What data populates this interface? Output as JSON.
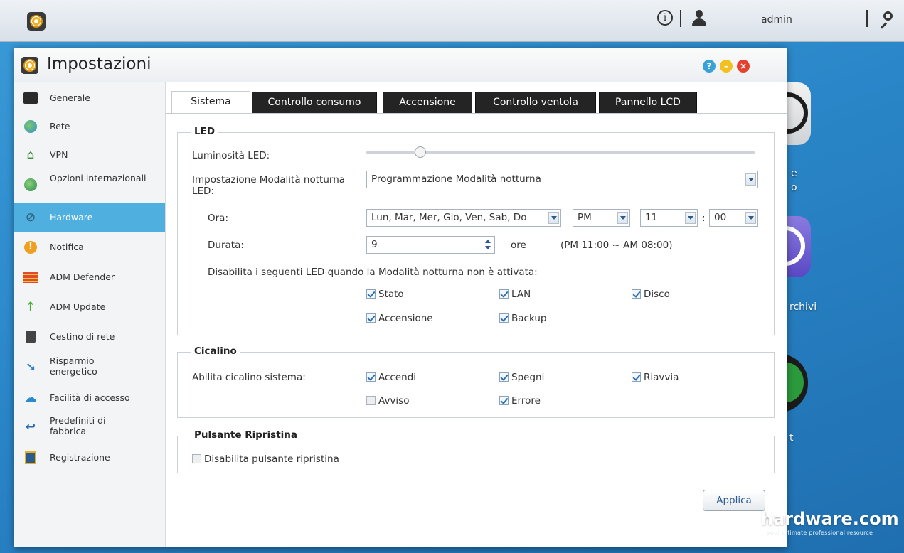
{
  "topbar": {
    "user": "admin"
  },
  "desktop": {
    "label_e": "e",
    "label_o": "o",
    "label_archivi": "rchivi",
    "label_t": "t"
  },
  "window": {
    "title": "Impostazioni"
  },
  "sidebar": {
    "items": [
      {
        "label": "Generale",
        "icon": "monitor-icon"
      },
      {
        "label": "Rete",
        "icon": "globe-icon"
      },
      {
        "label": "VPN",
        "icon": "vpn-icon"
      },
      {
        "label": "Opzioni internazionali",
        "icon": "globe-pin-icon"
      },
      {
        "label": "Hardware",
        "icon": "hardware-icon"
      },
      {
        "label": "Notifica",
        "icon": "alert-icon"
      },
      {
        "label": "ADM Defender",
        "icon": "firewall-icon"
      },
      {
        "label": "ADM Update",
        "icon": "update-arrow-icon"
      },
      {
        "label": "Cestino di rete",
        "icon": "trash-icon"
      },
      {
        "label": "Risparmio energetico",
        "icon": "energy-icon"
      },
      {
        "label": "Facilità di accesso",
        "icon": "cloud-access-icon"
      },
      {
        "label": "Predefiniti di fabbrica",
        "icon": "undo-icon"
      },
      {
        "label": "Registrazione",
        "icon": "registration-icon"
      }
    ]
  },
  "tabs": [
    "Sistema",
    "Controllo consumo",
    "Accensione",
    "Controllo ventola",
    "Pannello LCD"
  ],
  "led": {
    "legend": "LED",
    "brightness_label": "Luminosità LED:",
    "brightness_level": 0.14,
    "night_mode_label": "Impostazione Modalità notturna LED:",
    "night_mode_value": "Programmazione Modalità notturna",
    "time_label": "Ora:",
    "days_value": "Lun, Mar, Mer, Gio, Ven, Sab, Do",
    "ampm_value": "PM",
    "hour_value": "11",
    "minute_value": "00",
    "time_separator": ":",
    "duration_label": "Durata:",
    "duration_value": "9",
    "duration_unit": "ore",
    "duration_range": "(PM 11:00 ~ AM 08:00)",
    "disable_text": "Disabilita i seguenti LED quando la Modalità notturna non è attivata:",
    "checkboxes": [
      {
        "label": "Stato",
        "checked": true
      },
      {
        "label": "LAN",
        "checked": true
      },
      {
        "label": "Disco",
        "checked": true
      },
      {
        "label": "Accensione",
        "checked": true
      },
      {
        "label": "Backup",
        "checked": true
      }
    ]
  },
  "buzzer": {
    "legend": "Cicalino",
    "label": "Abilita cicalino sistema:",
    "checkboxes": [
      {
        "label": "Accendi",
        "checked": true
      },
      {
        "label": "Spegni",
        "checked": true
      },
      {
        "label": "Riavvia",
        "checked": true
      },
      {
        "label": "Avviso",
        "checked": false
      },
      {
        "label": "Errore",
        "checked": true
      }
    ]
  },
  "reset": {
    "legend": "Pulsante Ripristina",
    "checkbox_label": "Disabilita pulsante ripristina",
    "checked": false
  },
  "apply_label": "Applica",
  "watermark": {
    "brand": "hardware.com",
    "tagline": "your ultimate professional resource"
  },
  "colors": {
    "accent": "#4fb0e0",
    "tab_dark": "#242424",
    "close": "#e4412f",
    "minimize": "#f3c021",
    "help": "#39a3d8"
  }
}
